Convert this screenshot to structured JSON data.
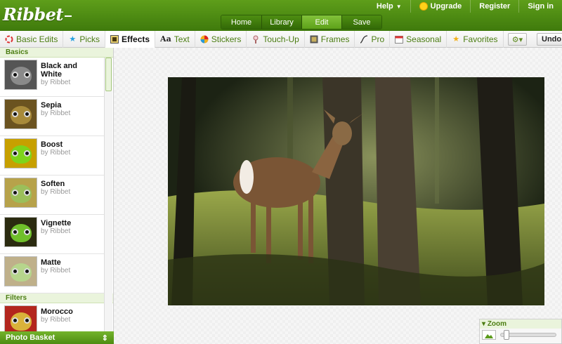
{
  "app": {
    "logo": "Ribbet"
  },
  "top_nav": [
    {
      "label": "Help",
      "caret": true
    },
    {
      "label": "Upgrade",
      "icon": "sun-icon"
    },
    {
      "label": "Register"
    },
    {
      "label": "Sign in"
    }
  ],
  "main_tabs": [
    {
      "label": "Home",
      "active": false
    },
    {
      "label": "Library",
      "active": false
    },
    {
      "label": "Edit",
      "active": true
    },
    {
      "label": "Save",
      "active": false
    }
  ],
  "toolbar": {
    "items": [
      {
        "label": "Basic Edits",
        "icon": "ring-icon",
        "active": false
      },
      {
        "label": "Picks",
        "icon": "star-icon",
        "active": false
      },
      {
        "label": "Effects",
        "icon": "effects-icon",
        "active": true
      },
      {
        "label": "Text",
        "icon": "text-icon",
        "glyph": "Aa",
        "active": false
      },
      {
        "label": "Stickers",
        "icon": "ball-icon",
        "active": false
      },
      {
        "label": "Touch-Up",
        "icon": "brush-icon",
        "active": false
      },
      {
        "label": "Frames",
        "icon": "frame-icon",
        "active": false
      },
      {
        "label": "Pro",
        "icon": "curve-icon",
        "active": false
      },
      {
        "label": "Seasonal",
        "icon": "calendar-icon",
        "active": false
      },
      {
        "label": "Favorites",
        "icon": "star-icon",
        "active": false
      }
    ],
    "gear": "⚙▾",
    "undo_label": "Undo"
  },
  "sidebar": {
    "sections": [
      {
        "title": "Basics",
        "effects": [
          {
            "name": "Black and White",
            "by": "by Ribbet",
            "tone": "#8a8a8a",
            "bg": "#555555"
          },
          {
            "name": "Sepia",
            "by": "by Ribbet",
            "tone": "#a88a3a",
            "bg": "#6b5320"
          },
          {
            "name": "Boost",
            "by": "by Ribbet",
            "tone": "#7ed41a",
            "bg": "#c7a000"
          },
          {
            "name": "Soften",
            "by": "by Ribbet",
            "tone": "#9bbf5a",
            "bg": "#b7a24a"
          },
          {
            "name": "Vignette",
            "by": "by Ribbet",
            "tone": "#6fbf2a",
            "bg": "#2b2b10"
          },
          {
            "name": "Matte",
            "by": "by Ribbet",
            "tone": "#b6d58c",
            "bg": "#bfb08a"
          }
        ]
      },
      {
        "title": "Filters",
        "effects": [
          {
            "name": "Morocco",
            "by": "by Ribbet",
            "tone": "#d9b23a",
            "bg": "#b3261e"
          }
        ]
      }
    ],
    "photo_basket": "Photo Basket",
    "photo_basket_arrow": "⇕"
  },
  "zoom": {
    "label": "Zoom",
    "level": 0.05
  },
  "colors": {
    "brand_green": "#4b7d12",
    "accent": "#6fb42a"
  }
}
